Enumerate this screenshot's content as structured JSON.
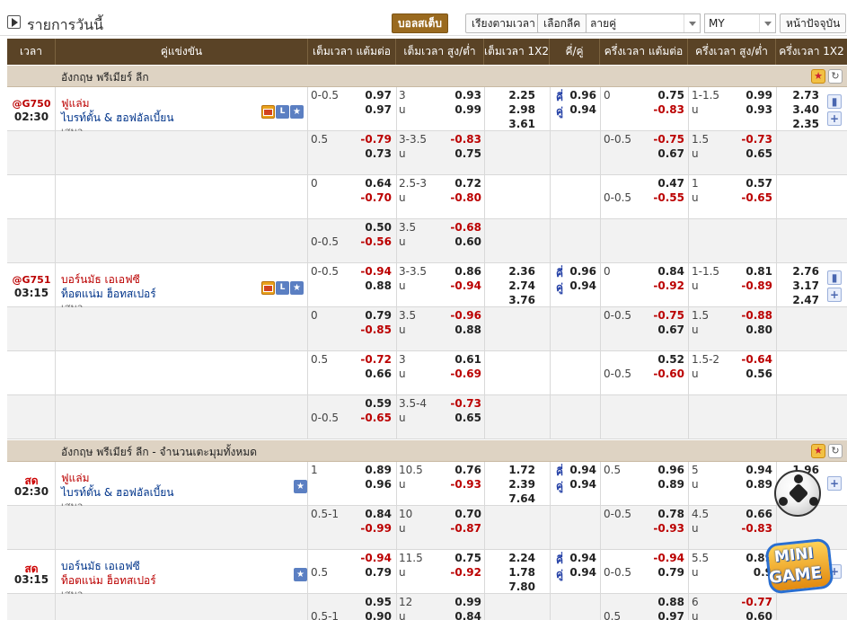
{
  "page": {
    "title": "รายการวันนี้",
    "toolbar": {
      "football": "บอลสเต็บ",
      "sort_time": "เรียงตามเวลา",
      "select_league": "เลือกลีค",
      "odd_even": "ลายคู่",
      "odds_type": "MY",
      "current_page": "หน้าปัจจุบัน"
    }
  },
  "columns": [
    "เวลา",
    "คู่แข่งขัน",
    "เต็มเวลา แต้มต่อ",
    "เต็มเวลา สูง/ต่ำ",
    "เต็มเวลา 1X2",
    "คี่/คู่",
    "ครึ่งเวลา แต้มต่อ",
    "ครึ่งเวลา สูง/ต่ำ",
    "ครึ่งเวลา 1X2"
  ],
  "labels": {
    "under": "u",
    "odd": "คี่",
    "even": "คู่",
    "draw": "เสมอ",
    "live": "สด"
  },
  "leagues": [
    {
      "name": "อังกฤษ พรีเมียร์ ลีก"
    },
    {
      "name": "อังกฤษ พรีเมียร์ ลีก - จำนวนเตะมุมทั้งหมด"
    }
  ],
  "rows": [
    {
      "code": "@G750",
      "time": "02:30",
      "home": "ฟูแล่ม",
      "away": "ไบรท์ตั้น & ฮอฟอัลเบี้ยน",
      "draw": "เสมอ",
      "fh_line1": "0-0.5",
      "fh_line2": "",
      "fh_1": "0.97",
      "fh_2": "0.97",
      "fo_line": "3",
      "fo_1": "0.93",
      "fo_2": "0.99",
      "x1": "2.25",
      "x2": "2.98",
      "x3": "3.61",
      "oe_1": "0.96",
      "oe_2": "0.94",
      "hh_line1": "0",
      "hh_line2": "",
      "hh_1": "0.75",
      "hh_2": "-0.83",
      "ho_line": "1-1.5",
      "ho_1": "0.99",
      "ho_2": "0.93",
      "hx1": "2.73",
      "hx2": "3.40",
      "hx3": "2.35"
    },
    {
      "fh_line1": "0.5",
      "fh_line2": "",
      "fh_1": "-0.79",
      "fh_2": "0.73",
      "fo_line": "3-3.5",
      "fo_1": "-0.83",
      "fo_2": "0.75",
      "hh_line1": "0-0.5",
      "hh_line2": "",
      "hh_1": "-0.75",
      "hh_2": "0.67",
      "ho_line": "1.5",
      "ho_1": "-0.73",
      "ho_2": "0.65"
    },
    {
      "fh_line1": "0",
      "fh_line2": "",
      "fh_1": "0.64",
      "fh_2": "-0.70",
      "fo_line": "2.5-3",
      "fo_1": "0.72",
      "fo_2": "-0.80",
      "hh_line1": "",
      "hh_line2": "0-0.5",
      "hh_1": "0.47",
      "hh_2": "-0.55",
      "ho_line": "1",
      "ho_1": "0.57",
      "ho_2": "-0.65"
    },
    {
      "fh_line1": "",
      "fh_line2": "0-0.5",
      "fh_1": "0.50",
      "fh_2": "-0.56",
      "fo_line": "3.5",
      "fo_1": "-0.68",
      "fo_2": "0.60"
    },
    {
      "code": "@G751",
      "time": "03:15",
      "home": "บอร์นมัธ เอเอฟซี",
      "away": "ท็อตแน่ม ฮ็อทสเปอร์",
      "draw": "เสมอ",
      "fh_line1": "0-0.5",
      "fh_line2": "",
      "fh_1": "-0.94",
      "fh_2": "0.88",
      "fo_line": "3-3.5",
      "fo_1": "0.86",
      "fo_2": "-0.94",
      "x1": "2.36",
      "x2": "2.74",
      "x3": "3.76",
      "oe_1": "0.96",
      "oe_2": "0.94",
      "hh_line1": "0",
      "hh_line2": "",
      "hh_1": "0.84",
      "hh_2": "-0.92",
      "ho_line": "1-1.5",
      "ho_1": "0.81",
      "ho_2": "-0.89",
      "hx1": "2.76",
      "hx2": "3.17",
      "hx3": "2.47"
    },
    {
      "fh_line1": "0",
      "fh_line2": "",
      "fh_1": "0.79",
      "fh_2": "-0.85",
      "fo_line": "3.5",
      "fo_1": "-0.96",
      "fo_2": "0.88",
      "hh_line1": "0-0.5",
      "hh_line2": "",
      "hh_1": "-0.75",
      "hh_2": "0.67",
      "ho_line": "1.5",
      "ho_1": "-0.88",
      "ho_2": "0.80"
    },
    {
      "fh_line1": "0.5",
      "fh_line2": "",
      "fh_1": "-0.72",
      "fh_2": "0.66",
      "fo_line": "3",
      "fo_1": "0.61",
      "fo_2": "-0.69",
      "hh_line1": "",
      "hh_line2": "0-0.5",
      "hh_1": "0.52",
      "hh_2": "-0.60",
      "ho_line": "1.5-2",
      "ho_1": "-0.64",
      "ho_2": "0.56"
    },
    {
      "fh_line1": "",
      "fh_line2": "0-0.5",
      "fh_1": "0.59",
      "fh_2": "-0.65",
      "fo_line": "3.5-4",
      "fo_1": "-0.73",
      "fo_2": "0.65"
    },
    {
      "live": true,
      "time": "02:30",
      "home": "ฟูแล่ม",
      "away": "ไบรท์ตั้น & ฮอฟอัลเบี้ยน",
      "draw": "เสมอ",
      "fh_line1": "1",
      "fh_line2": "",
      "fh_1": "0.89",
      "fh_2": "0.96",
      "fo_line": "10.5",
      "fo_1": "0.76",
      "fo_2": "-0.93",
      "x1": "1.72",
      "x2": "2.39",
      "x3": "7.64",
      "oe_1": "0.94",
      "oe_2": "0.94",
      "hh_line1": "0.5",
      "hh_line2": "",
      "hh_1": "0.96",
      "hh_2": "0.89",
      "ho_line": "5",
      "ho_1": "0.94",
      "ho_2": "0.89",
      "hx1": "1.96",
      "hx2": "",
      "hx3": ""
    },
    {
      "fh_line1": "0.5-1",
      "fh_line2": "",
      "fh_1": "0.84",
      "fh_2": "-0.99",
      "fo_line": "10",
      "fo_1": "0.70",
      "fo_2": "-0.87",
      "hh_line1": "0-0.5",
      "hh_line2": "",
      "hh_1": "0.78",
      "hh_2": "-0.93",
      "ho_line": "4.5",
      "ho_1": "0.66",
      "ho_2": "-0.83"
    },
    {
      "live": true,
      "time": "03:15",
      "home": "บอร์นมัธ เอเอฟซี",
      "away": "ท็อตแน่ม ฮ็อทสเปอร์",
      "draw": "เสมอ",
      "home_dog": true,
      "fh_line1": "",
      "fh_line2": "0.5",
      "fh_1": "-0.94",
      "fh_2": "0.79",
      "fo_line": "11.5",
      "fo_1": "0.75",
      "fo_2": "-0.92",
      "x1": "2.24",
      "x2": "1.78",
      "x3": "7.80",
      "oe_1": "0.94",
      "oe_2": "0.94",
      "hh_line1": "",
      "hh_line2": "0-0.5",
      "hh_1": "-0.94",
      "hh_2": "0.79",
      "ho_line": "5.5",
      "ho_1": "0.89",
      "ho_2": "0.9",
      "hx1": "",
      "hx2": "",
      "hx3": ""
    },
    {
      "fh_line1": "",
      "fh_line2": "0.5-1",
      "fh_1": "0.95",
      "fh_2": "0.90",
      "fo_line": "12",
      "fo_1": "0.99",
      "fo_2": "0.84",
      "hh_line1": "",
      "hh_line2": "0.5",
      "hh_1": "0.88",
      "hh_2": "0.97",
      "ho_line": "6",
      "ho_1": "-0.77",
      "ho_2": "0.60"
    }
  ],
  "logo": {
    "line1": "MINI",
    "line2": "GAME"
  }
}
